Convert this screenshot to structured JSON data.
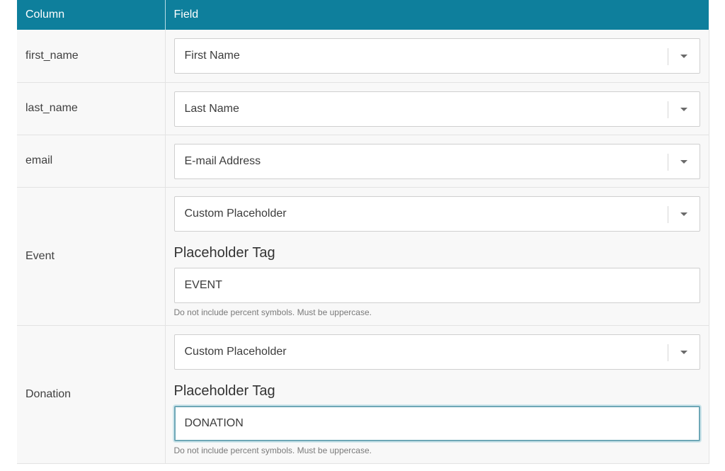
{
  "header": {
    "column_label": "Column",
    "field_label": "Field"
  },
  "rows": [
    {
      "column": "first_name",
      "field_value": "First Name"
    },
    {
      "column": "last_name",
      "field_value": "Last Name"
    },
    {
      "column": "email",
      "field_value": "E-mail Address"
    },
    {
      "column": "Event",
      "field_value": "Custom Placeholder",
      "placeholder_title": "Placeholder Tag",
      "placeholder_value": "EVENT",
      "help": "Do not include percent symbols. Must be uppercase."
    },
    {
      "column": "Donation",
      "field_value": "Custom Placeholder",
      "placeholder_title": "Placeholder Tag",
      "placeholder_value": "DONATION",
      "help": "Do not include percent symbols. Must be uppercase."
    }
  ],
  "colors": {
    "header_bg": "#0e7f9c",
    "row_bg": "#f8f8f8",
    "focus_border": "#6ea7b6"
  }
}
